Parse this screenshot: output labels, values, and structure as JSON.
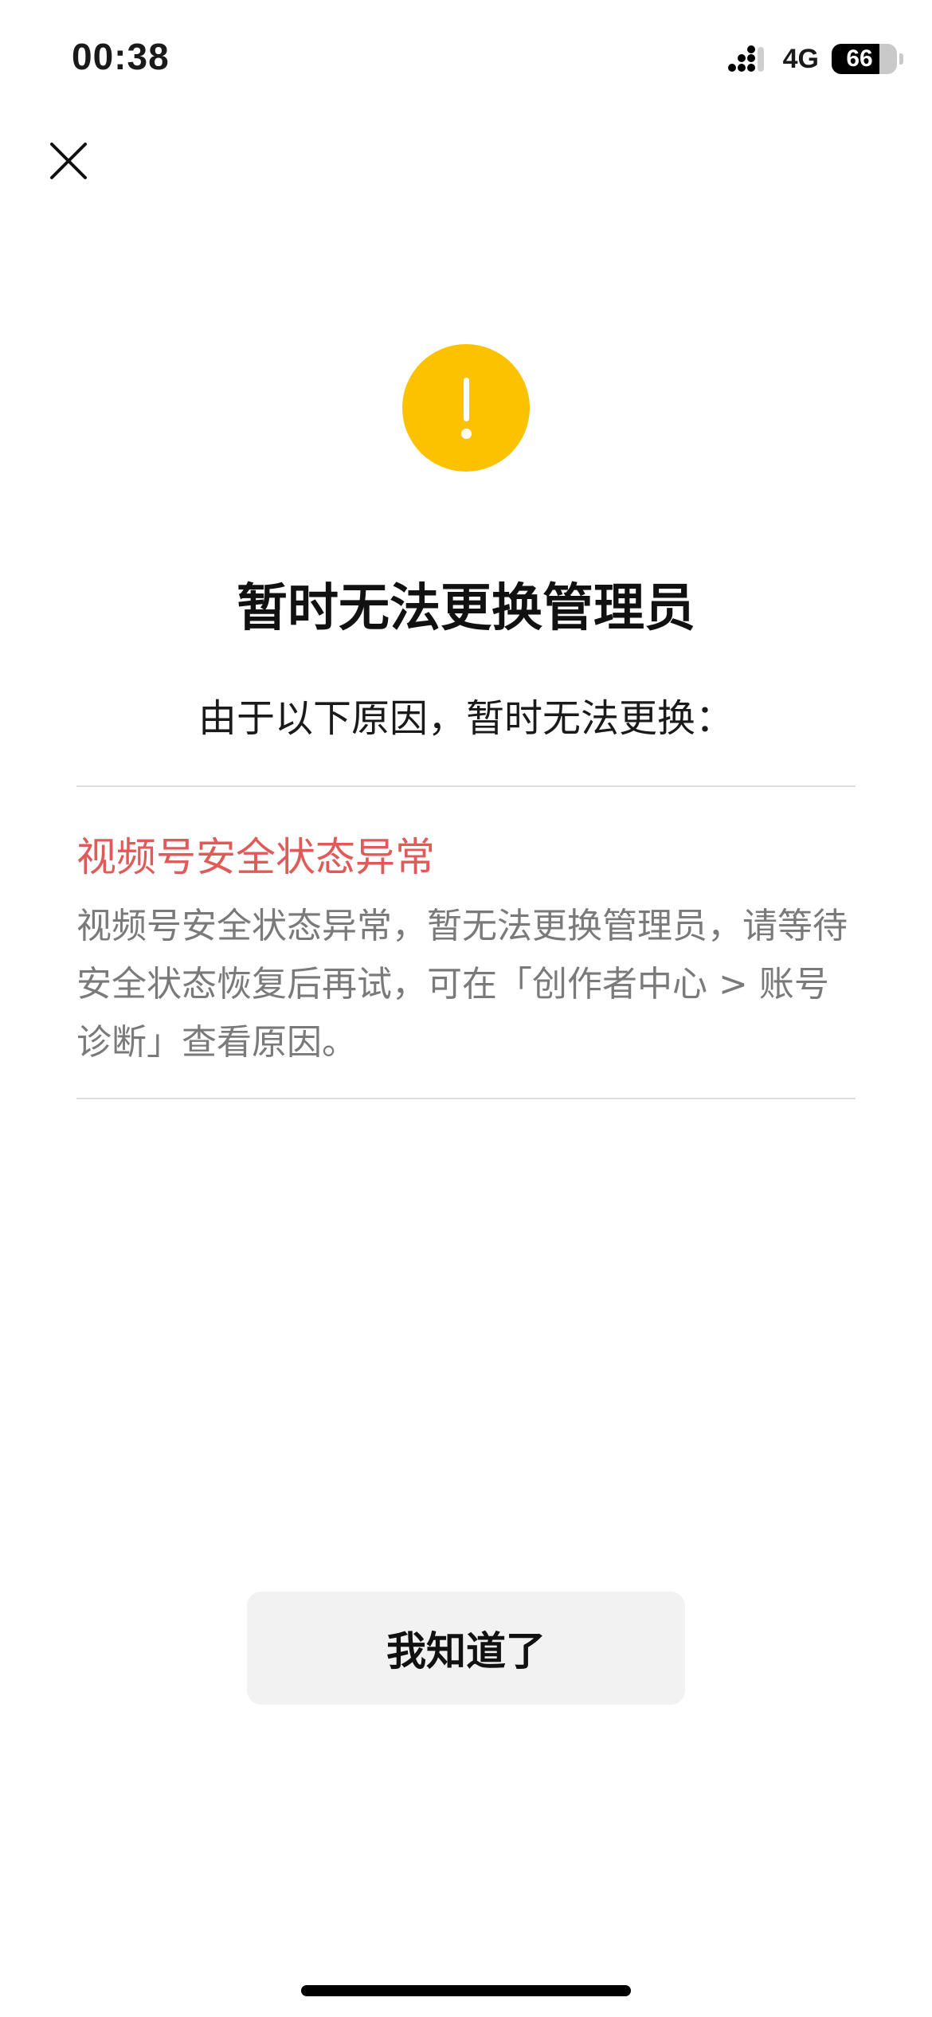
{
  "status_bar": {
    "time": "00:38",
    "network": "4G",
    "battery": "66",
    "icons": {
      "signal": "signal-bars-icon",
      "battery": "battery-icon"
    }
  },
  "close_icon": "close-icon",
  "warning_icon": "exclamation-circle-icon",
  "colors": {
    "warning": "#fcc200",
    "reason_title": "#e05a5a",
    "body_text": "#7a7a7a",
    "button_bg": "#f2f2f2"
  },
  "header": {
    "title": "暂时无法更换管理员",
    "subtitle": "由于以下原因，暂时无法更换："
  },
  "reason": {
    "title": "视频号安全状态异常",
    "description": "视频号安全状态异常，暂无法更换管理员，请等待安全状态恢复后再试，可在「创作者中心 > 账号诊断」查看原因。"
  },
  "actions": {
    "confirm_label": "我知道了"
  }
}
